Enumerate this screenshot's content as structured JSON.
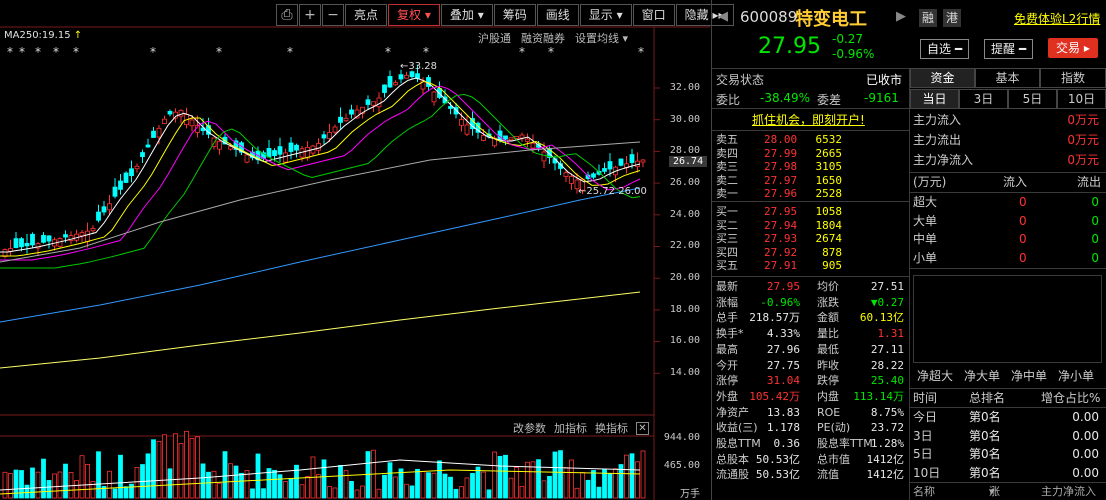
{
  "toolbar": {
    "buttons": [
      "亮点",
      "复权",
      "叠加",
      "筹码",
      "画线",
      "显示",
      "窗口",
      "隐藏"
    ],
    "active": "复权"
  },
  "chart": {
    "ma_label": "MA250:19.15",
    "sub_tools": [
      "沪股通",
      "融资融券",
      "设置均线"
    ],
    "indicator_tools": [
      "改参数",
      "加指标",
      "换指标"
    ],
    "y_ticks_price": [
      "32.00",
      "30.00",
      "28.00",
      "26.00",
      "24.00",
      "22.00",
      "20.00",
      "18.00",
      "16.00",
      "14.00"
    ],
    "current_price_tag": "26.74",
    "high_marker": "33.28",
    "low_marker": "25.72",
    "low_marker2": "26.00",
    "y_ticks_volume": [
      "944.00",
      "465.00",
      "万手"
    ],
    "colors": {
      "up": "#ff3232",
      "down": "#00ffff",
      "bg": "#000000"
    }
  },
  "stock": {
    "code": "600089",
    "name": "特变电工",
    "price": "27.95",
    "change": "-0.27",
    "change_pct": "-0.96%",
    "tag_rong": "融",
    "tag_gang": "港",
    "promo_link": "免费体验L2行情",
    "btn_watch": "自选",
    "btn_alert": "提醒",
    "btn_trade": "交易"
  },
  "status": {
    "label": "交易状态",
    "value": "已收市",
    "weibi_label": "委比",
    "weibi": "-38.49%",
    "weicha_label": "委差",
    "weicha": "-9161",
    "banner": "抓住机会，即刻开户!"
  },
  "orderbook": {
    "asks": [
      {
        "label": "卖五",
        "price": "28.00",
        "vol": "6532"
      },
      {
        "label": "卖四",
        "price": "27.99",
        "vol": "2665"
      },
      {
        "label": "卖三",
        "price": "27.98",
        "vol": "3105"
      },
      {
        "label": "卖二",
        "price": "27.97",
        "vol": "1650"
      },
      {
        "label": "卖一",
        "price": "27.96",
        "vol": "2528"
      }
    ],
    "bids": [
      {
        "label": "买一",
        "price": "27.95",
        "vol": "1058"
      },
      {
        "label": "买二",
        "price": "27.94",
        "vol": "1804"
      },
      {
        "label": "买三",
        "price": "27.93",
        "vol": "2674"
      },
      {
        "label": "买四",
        "price": "27.92",
        "vol": "878"
      },
      {
        "label": "买五",
        "price": "27.91",
        "vol": "905"
      }
    ]
  },
  "quote": [
    {
      "l1": "最新",
      "v1": "27.95",
      "c1": "red",
      "l2": "均价",
      "v2": "27.51",
      "c2": "white"
    },
    {
      "l1": "涨幅",
      "v1": "-0.96%",
      "c1": "green",
      "l2": "涨跌",
      "v2": "▼0.27",
      "c2": "green"
    },
    {
      "l1": "总手",
      "v1": "218.57万",
      "c1": "white",
      "l2": "金额",
      "v2": "60.13亿",
      "c2": "yellow"
    },
    {
      "l1": "换手*",
      "v1": "4.33%",
      "c1": "white",
      "l2": "量比",
      "v2": "1.31",
      "c2": "red"
    },
    {
      "l1": "最高",
      "v1": "27.96",
      "c1": "white",
      "l2": "最低",
      "v2": "27.11",
      "c2": "white"
    },
    {
      "l1": "今开",
      "v1": "27.75",
      "c1": "white",
      "l2": "昨收",
      "v2": "28.22",
      "c2": "white"
    },
    {
      "l1": "涨停",
      "v1": "31.04",
      "c1": "red",
      "l2": "跌停",
      "v2": "25.40",
      "c2": "green"
    },
    {
      "l1": "外盘",
      "v1": "105.42万",
      "c1": "red",
      "l2": "内盘",
      "v2": "113.14万",
      "c2": "green"
    },
    {
      "l1": "净资产",
      "v1": "13.83",
      "c1": "white",
      "l2": "ROE",
      "v2": "8.75%",
      "c2": "white"
    },
    {
      "l1": "收益(三)",
      "v1": "1.178",
      "c1": "white",
      "l2": "PE(动)",
      "v2": "23.72",
      "c2": "white"
    },
    {
      "l1": "股息TTM",
      "v1": "0.36",
      "c1": "white",
      "l2": "股息率TTM",
      "v2": "1.28%",
      "c2": "white"
    },
    {
      "l1": "总股本",
      "v1": "50.53亿",
      "c1": "white",
      "l2": "总市值",
      "v2": "1412亿",
      "c2": "white"
    },
    {
      "l1": "流通股",
      "v1": "50.53亿",
      "c1": "white",
      "l2": "流值",
      "v2": "1412亿",
      "c2": "white"
    }
  ],
  "fund": {
    "tabs": [
      "资金",
      "基本",
      "指数"
    ],
    "period_tabs": [
      "当日",
      "3日",
      "5日",
      "10日"
    ],
    "main_flow": [
      {
        "label": "主力流入",
        "value": "0万元"
      },
      {
        "label": "主力流出",
        "value": "0万元"
      },
      {
        "label": "主力净流入",
        "value": "0万元"
      }
    ],
    "table_headers": [
      "(万元)",
      "流入",
      "流出"
    ],
    "table_rows": [
      {
        "label": "超大",
        "in": "0",
        "out": "0"
      },
      {
        "label": "大单",
        "in": "0",
        "out": "0"
      },
      {
        "label": "中单",
        "in": "0",
        "out": "0"
      },
      {
        "label": "小单",
        "in": "0",
        "out": "0"
      }
    ],
    "net_labels": [
      "净超大",
      "净大单",
      "净中单",
      "净小单"
    ],
    "rank_headers": [
      "时间",
      "总排名",
      "增仓占比%"
    ],
    "rank_rows": [
      {
        "t": "今日",
        "rank": "第0名",
        "pct": "0.00"
      },
      {
        "t": "3日",
        "rank": "第0名",
        "pct": "0.00"
      },
      {
        "t": "5日",
        "rank": "第0名",
        "pct": "0.00"
      },
      {
        "t": "10日",
        "rank": "第0名",
        "pct": "0.00"
      }
    ],
    "footer_headers": [
      "名称",
      "涨幅",
      "主力净流入"
    ]
  }
}
